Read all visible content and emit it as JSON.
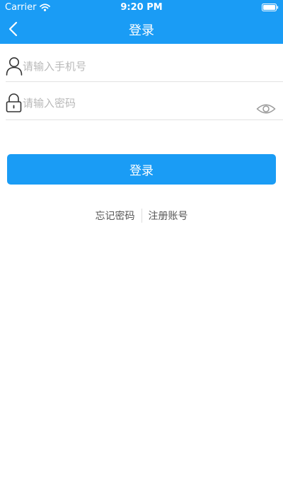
{
  "status_bar": {
    "carrier": "Carrier",
    "time": "9:20 PM"
  },
  "nav": {
    "title": "登录",
    "back_icon": "chevron-left-icon"
  },
  "form": {
    "phone_placeholder": "请输入手机号",
    "phone_value": "",
    "phone_icon": "user-icon",
    "password_placeholder": "请输入密码",
    "password_value": "",
    "password_icon": "lock-icon",
    "visibility_icon": "eye-icon"
  },
  "actions": {
    "login_label": "登录",
    "forgot_label": "忘记密码",
    "register_label": "注册账号"
  },
  "colors": {
    "primary": "#1a9cf5",
    "placeholder": "#b9b9b9",
    "link_text": "#555555",
    "divider": "#e2e2e2"
  }
}
